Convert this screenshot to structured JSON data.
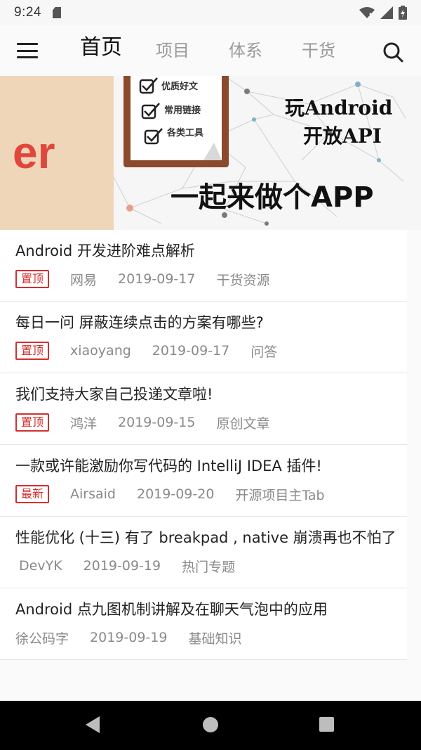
{
  "status_bar": {
    "time": "9:24",
    "icons": [
      "sd-card-icon",
      "wifi-icon",
      "cellular-signal-icon",
      "battery-icon"
    ]
  },
  "app_bar": {
    "menu_icon": "hamburger-menu-icon",
    "search_icon": "search-icon",
    "tabs": [
      {
        "label": "首页",
        "active": true
      },
      {
        "label": "项目",
        "active": false
      },
      {
        "label": "体系",
        "active": false
      },
      {
        "label": "干货",
        "active": false
      }
    ]
  },
  "banner": {
    "checklist": [
      "优质好文",
      "常用链接",
      "各类工具"
    ],
    "headline_line1": "玩Android",
    "headline_line2": "开放API",
    "slogan": "一起来做个APP",
    "left_text": "er",
    "colors": {
      "left_panel": "#f0d6b9",
      "left_text": "#e0463c",
      "clipboard": "#8b4a2b"
    }
  },
  "articles": [
    {
      "title": "Android 开发进阶难点解析",
      "badge": "置顶",
      "author": "网易",
      "date": "2019-09-17",
      "category": "干货资源"
    },
    {
      "title": "每日一问 屏蔽连续点击的方案有哪些?",
      "badge": "置顶",
      "author": "xiaoyang",
      "date": "2019-09-17",
      "category": "问答"
    },
    {
      "title": "我们支持大家自己投递文章啦!",
      "badge": "置顶",
      "author": "鸿洋",
      "date": "2019-09-15",
      "category": "原创文章"
    },
    {
      "title": "一款或许能激励你写代码的 IntelliJ IDEA 插件!",
      "badge": "最新",
      "author": "Airsaid",
      "date": "2019-09-20",
      "category": "开源项目主Tab"
    },
    {
      "title": "性能优化 (十三) 有了 breakpad , native 崩溃再也不怕了",
      "badge": "",
      "author": "DevYK",
      "date": "2019-09-19",
      "category": "热门专题"
    },
    {
      "title": "Android 点九图机制讲解及在聊天气泡中的应用",
      "badge": "",
      "author": "徐公码字",
      "date": "2019-09-19",
      "category": "基础知识"
    }
  ],
  "colors": {
    "accent": "#d32f2f",
    "meta_text": "#8a8a8a",
    "navbar": "#000000"
  },
  "nav_bar": {
    "buttons": [
      "back-icon",
      "home-icon",
      "recents-icon"
    ]
  }
}
